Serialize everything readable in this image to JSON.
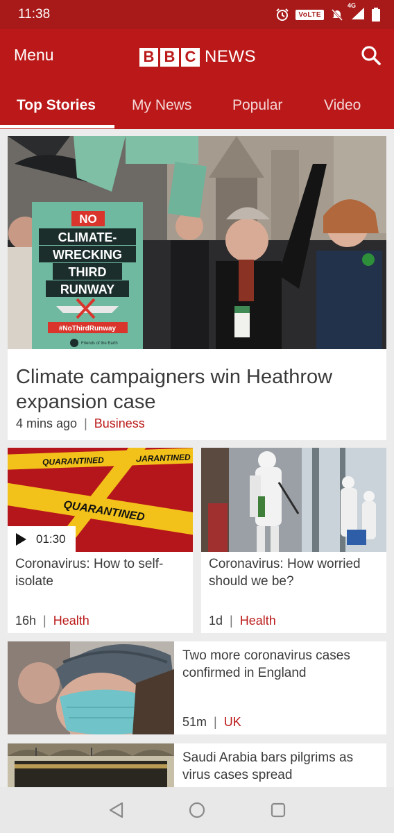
{
  "status_bar": {
    "time": "11:38",
    "network_badge": "VoLTE",
    "signal_label": "4G",
    "icons": [
      "alarm-icon",
      "mute-icon",
      "signal-icon",
      "battery-icon"
    ]
  },
  "header": {
    "menu_label": "Menu",
    "logo_letters": [
      "B",
      "B",
      "C"
    ],
    "logo_word": "NEWS",
    "search_icon": "search-icon",
    "brand_color": "#bb1919"
  },
  "tabs": [
    {
      "label": "Top Stories",
      "active": true
    },
    {
      "label": "My News",
      "active": false
    },
    {
      "label": "Popular",
      "active": false
    },
    {
      "label": "Video",
      "active": false
    }
  ],
  "lead_story": {
    "title": "Climate campaigners win Heathrow expansion case",
    "time": "4 mins ago",
    "topic": "Business",
    "image_sign_lines": [
      "NO",
      "CLIMATE-",
      "WRECKING",
      "THIRD",
      "RUNWAY"
    ],
    "image_hashtag": "#NoThirdRunway",
    "image_caption": "Friends of the Earth"
  },
  "half_stories": [
    {
      "title": "Coronavirus: How to self-isolate",
      "time": "16h",
      "topic": "Health",
      "video_duration": "01:30",
      "tape_text": "QUARANTINED"
    },
    {
      "title": "Coronavirus: How worried should we be?",
      "time": "1d",
      "topic": "Health"
    }
  ],
  "row_stories": [
    {
      "title": "Two more coronavirus cases confirmed in England",
      "time": "51m",
      "topic": "UK"
    },
    {
      "title": "Saudi Arabia bars pilgrims as virus cases spread"
    }
  ],
  "nav": {
    "icons": [
      "back-icon",
      "home-icon",
      "recents-icon"
    ]
  }
}
